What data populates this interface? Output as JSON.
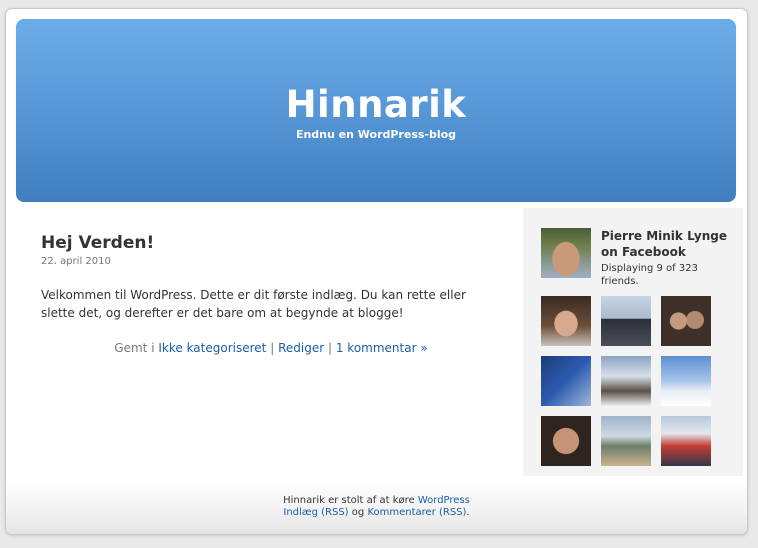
{
  "header": {
    "title": "Hinnarik",
    "description": "Endnu en WordPress-blog"
  },
  "post": {
    "title": "Hej Verden!",
    "date": "22. april 2010",
    "body": "Velkommen til WordPress. Dette er dit første indlæg. Du kan rette eller slette det, og derefter er det bare om at begynde at blogge!",
    "meta_prefix": "Gemt i",
    "category_link": "Ikke kategoriseret",
    "separator": "|",
    "edit_link": "Rediger",
    "comments_link": "1 kommentar »"
  },
  "facebook": {
    "name": "Pierre Minik Lynge on Facebook",
    "count_text": "Displaying 9 of 323 friends.",
    "friends": [
      {
        "icon": "friend-photo-1"
      },
      {
        "icon": "friend-photo-2"
      },
      {
        "icon": "friend-photo-3"
      },
      {
        "icon": "friend-photo-4"
      },
      {
        "icon": "friend-photo-5"
      },
      {
        "icon": "friend-photo-6"
      },
      {
        "icon": "friend-photo-7"
      },
      {
        "icon": "friend-photo-8"
      },
      {
        "icon": "friend-photo-9"
      }
    ]
  },
  "footer": {
    "text_before": "Hinnarik er stolt af at køre",
    "wordpress_link": "WordPress",
    "posts_rss_link": "Indlæg (RSS)",
    "and_text": "og",
    "comments_rss_link": "Kommentarer (RSS)",
    "period": "."
  }
}
